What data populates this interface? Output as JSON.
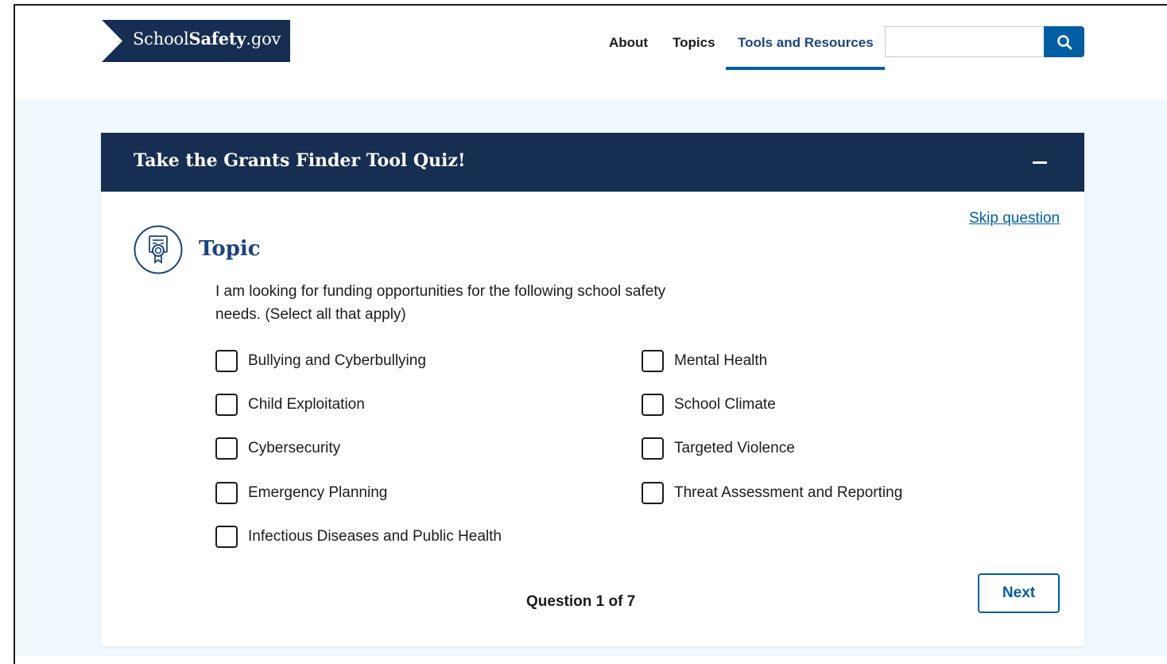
{
  "header": {
    "logo": {
      "prefix": "School",
      "bold": "Safety",
      "suffix": ".gov"
    },
    "nav": [
      {
        "label": "About"
      },
      {
        "label": "Topics"
      },
      {
        "label": "Tools and Resources",
        "active": true
      }
    ],
    "search": {
      "value": "",
      "button_icon": "search-icon"
    }
  },
  "quiz": {
    "title": "Take the Grants Finder Tool Quiz!",
    "collapse_icon": "minus-icon",
    "skip_label": "Skip question",
    "section": {
      "icon": "certificate-magnifier-icon",
      "heading": "Topic",
      "prompt": "I am looking for funding opportunities for the following school safety needs. (Select all that apply)"
    },
    "options_left": [
      {
        "label": "Bullying and Cyberbullying",
        "checked": false
      },
      {
        "label": "Child Exploitation",
        "checked": false
      },
      {
        "label": "Cybersecurity",
        "checked": false
      },
      {
        "label": "Emergency Planning",
        "checked": false
      },
      {
        "label": "Infectious Diseases and Public Health",
        "checked": false
      }
    ],
    "options_right": [
      {
        "label": "Mental Health",
        "checked": false
      },
      {
        "label": "School Climate",
        "checked": false
      },
      {
        "label": "Targeted Violence",
        "checked": false
      },
      {
        "label": "Threat Assessment and Reporting",
        "checked": false
      }
    ],
    "progress_text": "Question 1 of 7",
    "next_label": "Next"
  },
  "colors": {
    "navy": "#162e51",
    "primary": "#005ea2",
    "heading_blue": "#1a4480",
    "band": "#eff8fd"
  }
}
